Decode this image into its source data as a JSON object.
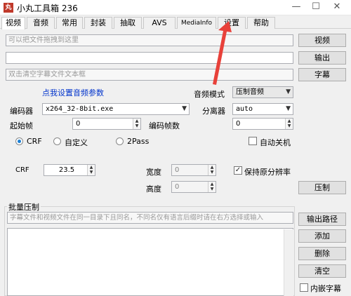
{
  "window": {
    "title": "小丸工具箱 236",
    "icon_text": "丸",
    "min": "—",
    "max": "☐",
    "close": "✕"
  },
  "tabs": [
    "视频",
    "音频",
    "常用",
    "封装",
    "抽取",
    "AVS",
    "MediaInfo",
    "设置",
    "帮助"
  ],
  "video": {
    "drop_placeholder": "可以把文件拖拽到这里",
    "output_value": "",
    "subtitle_placeholder": "双击清空字幕文件文本框",
    "btn_video": "视频",
    "btn_output": "输出",
    "btn_subtitle": "字幕",
    "audio_settings_link": "点我设置音频参数",
    "audio_mode_label": "音频模式",
    "audio_mode_value": "压制音频",
    "encoder_label": "编码器",
    "encoder_value": "x264_32-8bit.exe",
    "splitter_label": "分离器",
    "splitter_value": "auto",
    "start_frame_label": "起始帧",
    "start_frame_value": "0",
    "encode_frames_label": "编码帧数",
    "encode_frames_value": "0",
    "radio_crf": "CRF",
    "radio_custom": "自定义",
    "radio_2pass": "2Pass",
    "auto_shutdown": "自动关机",
    "crf_label": "CRF",
    "crf_value": "23.5",
    "width_label": "宽度",
    "width_value": "0",
    "height_label": "高度",
    "height_value": "0",
    "keep_res": "保持原分辨率",
    "btn_encode": "压制"
  },
  "batch": {
    "group_title": "批量压制",
    "hint": "字幕文件和视频文件在同一目录下且同名，不同名仅有语言后缀时请在右方选择或输入",
    "btn_output_path": "输出路径",
    "btn_add": "添加",
    "btn_delete": "删除",
    "btn_clear": "清空",
    "embed_subtitle": "内嵌字幕"
  },
  "icons": {
    "arrow": "red-annotation-arrow"
  },
  "colors": {
    "link": "#0033cc",
    "annotation": "#e8413a",
    "radio_accent": "#1a7fd4"
  }
}
